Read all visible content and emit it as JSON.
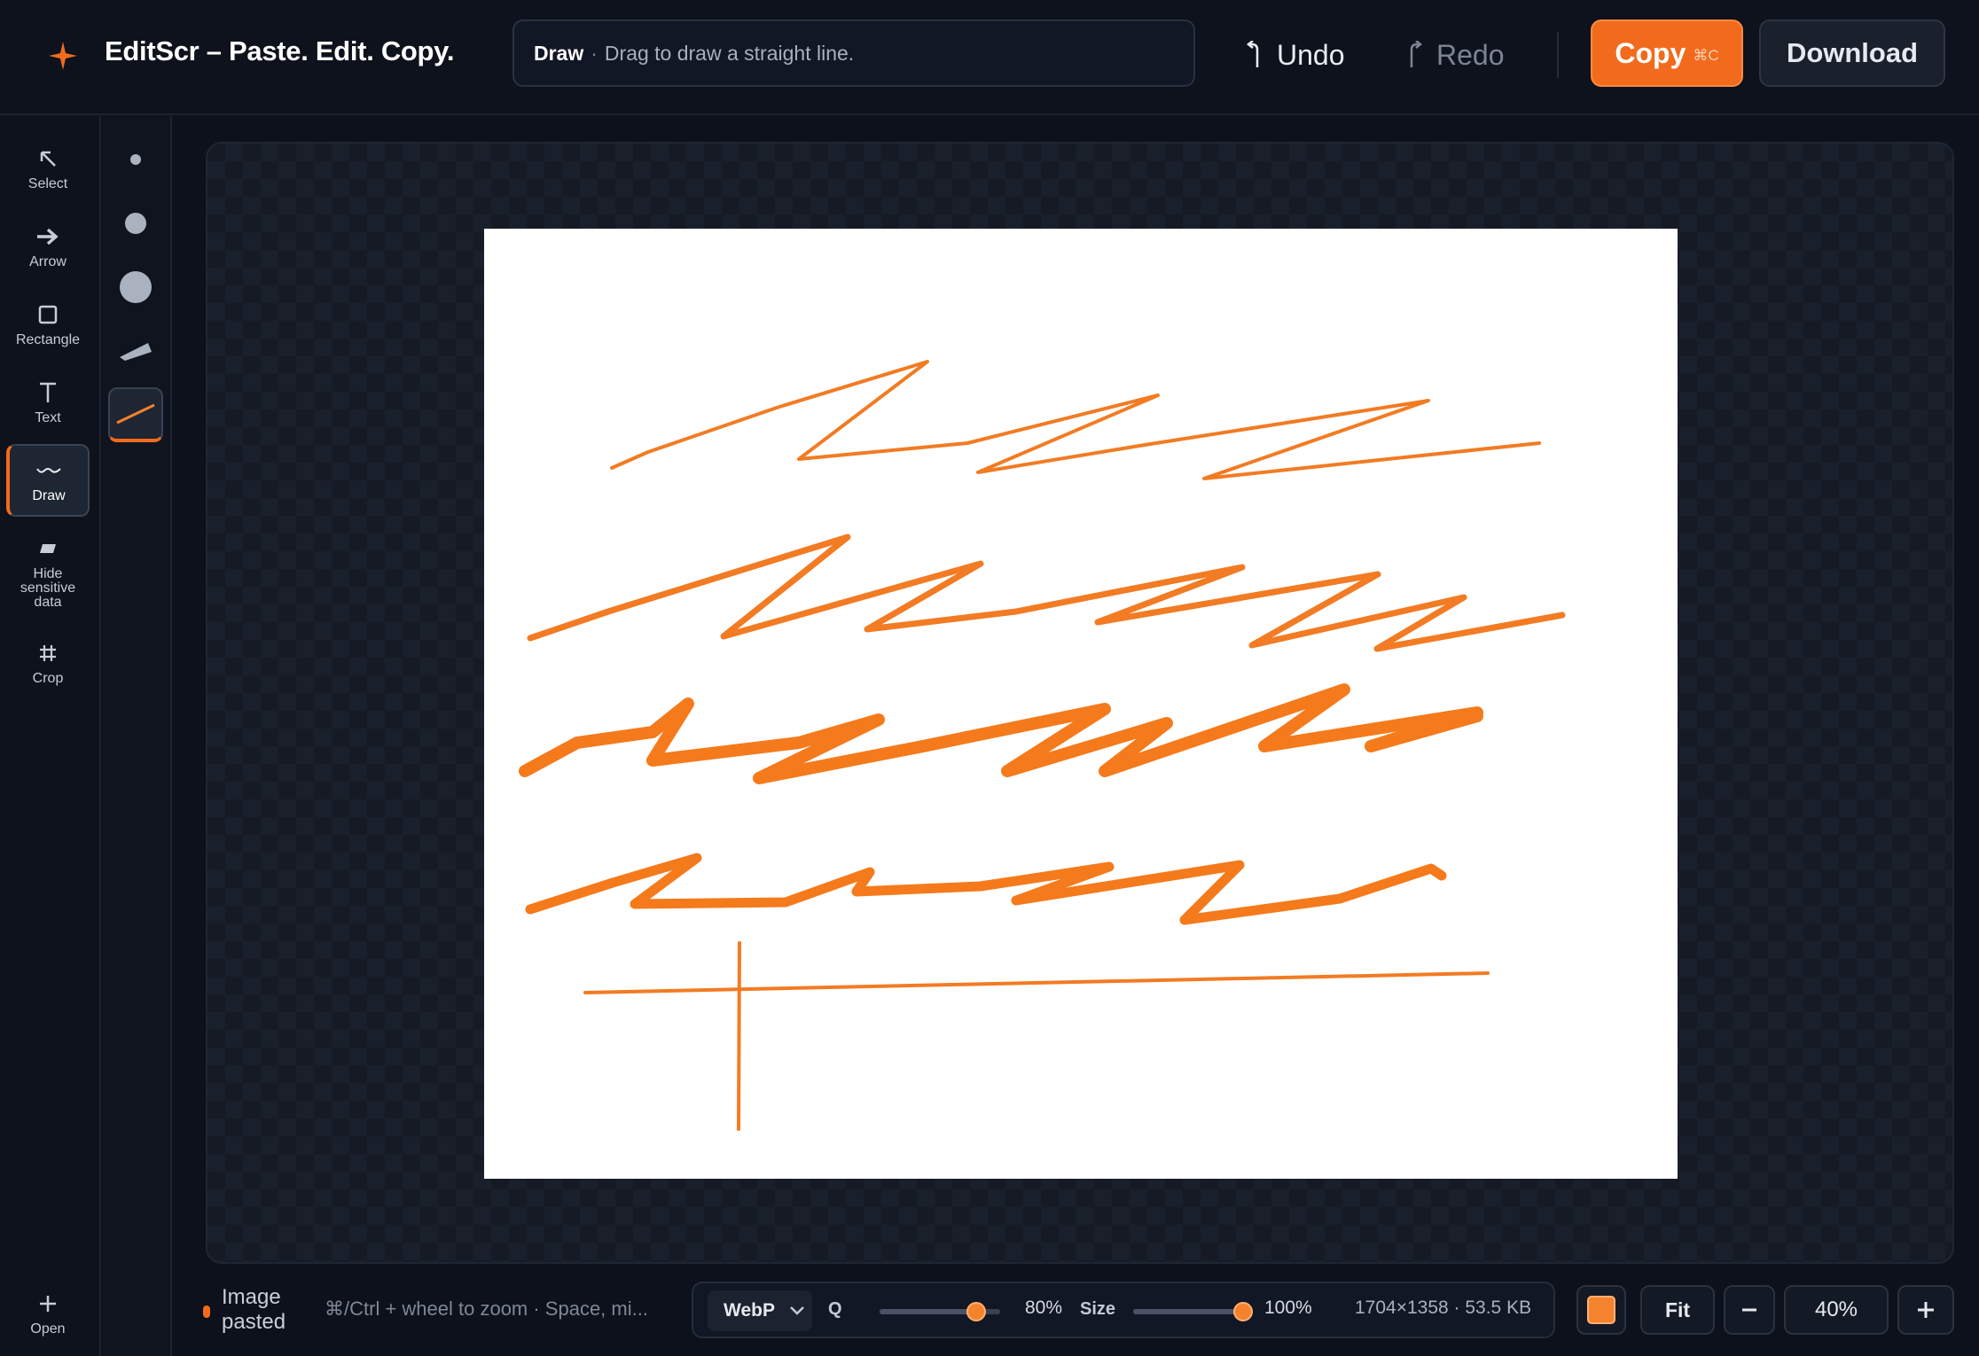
{
  "app": {
    "title": "EditScr – Paste. Edit. Copy.",
    "logo_icon": "sparkle-icon",
    "accent_color": "#f26b1d"
  },
  "hint": {
    "tool": "Draw",
    "separator": "·",
    "text": "Drag to draw a straight line."
  },
  "header": {
    "undo_label": "Undo",
    "redo_label": "Redo",
    "copy_label": "Copy",
    "copy_shortcut": "⌘C",
    "download_label": "Download"
  },
  "toolbar": {
    "items": [
      {
        "id": "select",
        "label": "Select",
        "icon": "pointer-arrow-icon"
      },
      {
        "id": "arrow",
        "label": "Arrow",
        "icon": "right-arrow-icon"
      },
      {
        "id": "rectangle",
        "label": "Rectangle",
        "icon": "square-icon"
      },
      {
        "id": "text",
        "label": "Text",
        "icon": "text-t-icon"
      },
      {
        "id": "draw",
        "label": "Draw",
        "icon": "squiggle-icon",
        "active": true
      },
      {
        "id": "hide",
        "label": "Hide sensitive data",
        "icon": "redact-icon"
      },
      {
        "id": "crop",
        "label": "Crop",
        "icon": "crop-grid-icon"
      }
    ],
    "open_label": "Open"
  },
  "stroke_options": [
    {
      "id": "small",
      "icon": "dot-small-icon"
    },
    {
      "id": "medium",
      "icon": "dot-medium-icon"
    },
    {
      "id": "large",
      "icon": "dot-large-icon"
    },
    {
      "id": "marker",
      "icon": "marker-icon"
    },
    {
      "id": "line",
      "icon": "straight-line-icon",
      "active": true
    }
  ],
  "status": {
    "message": "Image pasted",
    "zoom_hint": "⌘/Ctrl + wheel to zoom · Space, mi..."
  },
  "export": {
    "format": "WebP",
    "quality_label": "Q",
    "quality_percent": 80,
    "quality_text": "80%",
    "size_label": "Size",
    "size_percent": 100,
    "size_text": "100%",
    "dimensions": "1704×1358 · 53.5 KB"
  },
  "view": {
    "stroke_color": "#f5822c",
    "fit_label": "Fit",
    "zoom_text": "40%"
  }
}
